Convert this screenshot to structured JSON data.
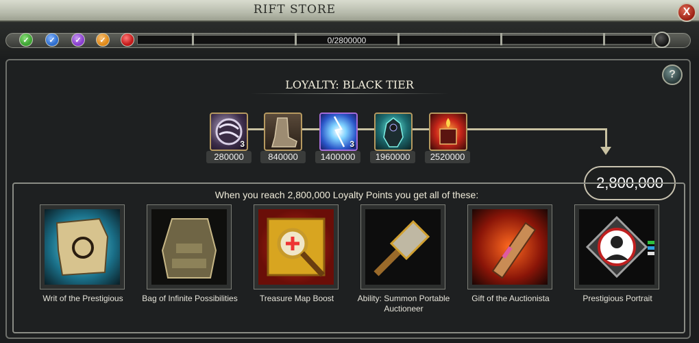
{
  "window": {
    "title": "RIFT STORE",
    "close_label": "X"
  },
  "progress": {
    "text": "0/2800000",
    "fraction": 0,
    "gems": [
      {
        "name": "green-gem-icon",
        "color": "#3fa535"
      },
      {
        "name": "blue-gem-icon",
        "color": "#2f6fcf"
      },
      {
        "name": "purple-gem-icon",
        "color": "#8a3fd0"
      },
      {
        "name": "orange-gem-icon",
        "color": "#e08a1a"
      },
      {
        "name": "red-gem-icon",
        "color": "#c41a1a"
      }
    ]
  },
  "loyalty": {
    "title": "LOYALTY: BLACK TIER",
    "help_label": "?",
    "milestones": [
      {
        "value": "280000",
        "count": "3",
        "icon": "sphere-icon"
      },
      {
        "value": "840000",
        "count": "",
        "icon": "boot-icon"
      },
      {
        "value": "1400000",
        "count": "3",
        "icon": "lightning-icon"
      },
      {
        "value": "1960000",
        "count": "",
        "icon": "armor-icon"
      },
      {
        "value": "2520000",
        "count": "",
        "icon": "fire-shrine-icon"
      }
    ],
    "total": "2,800,000"
  },
  "rewards": {
    "heading": "When you reach 2,800,000 Loyalty Points you get all of these:",
    "items": [
      {
        "label": "Writ of the Prestigious",
        "icon": "scroll-icon"
      },
      {
        "label": "Bag of Infinite Possibilities",
        "icon": "backpack-icon"
      },
      {
        "label": "Treasure Map Boost",
        "icon": "treasure-map-icon"
      },
      {
        "label": "Ability: Summon Portable Auctioneer",
        "icon": "hammer-icon"
      },
      {
        "label": "Gift of the Auctionista",
        "icon": "rolled-scroll-icon"
      },
      {
        "label": "Prestigious Portrait",
        "icon": "portrait-icon"
      }
    ]
  }
}
